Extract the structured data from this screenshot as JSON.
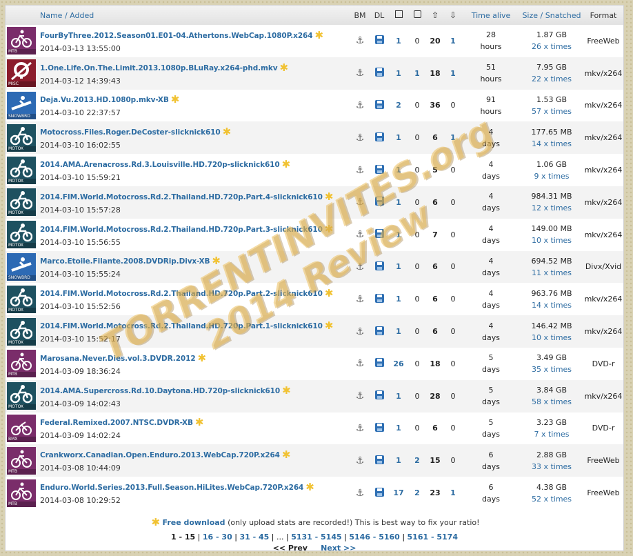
{
  "header": {
    "name": "Name",
    "slash": " / ",
    "added": "Added",
    "bm": "BM",
    "dl": "DL",
    "time_alive": "Time alive",
    "size": "Size",
    "snatched": "Snatched",
    "format": "Format"
  },
  "rows": [
    {
      "cat": "MTB",
      "name": "FourByThree.2012.Season01.E01-04.Athertons.WebCap.1080P.x264",
      "date": "2014-03-13 13:55:00",
      "files": "1",
      "comments": "0",
      "seed": "20",
      "leech": "1",
      "alive_n": "28",
      "alive_u": "hours",
      "size": "1.87 GB",
      "snatched": "26 x times",
      "format": "FreeWeb"
    },
    {
      "cat": "MISC",
      "name": "1.One.Life.On.The.Limit.2013.1080p.BLuRay.x264-phd.mkv",
      "date": "2014-03-12 14:39:43",
      "files": "1",
      "comments": "1",
      "seed": "18",
      "leech": "1",
      "alive_n": "51",
      "alive_u": "hours",
      "size": "7.95 GB",
      "snatched": "22 x times",
      "format": "mkv/x264"
    },
    {
      "cat": "SNOWBRD",
      "name": "Deja.Vu.2013.HD.1080p.mkv-XB",
      "date": "2014-03-10 22:37:57",
      "files": "2",
      "comments": "0",
      "seed": "36",
      "leech": "0",
      "alive_n": "91",
      "alive_u": "hours",
      "size": "1.53 GB",
      "snatched": "57 x times",
      "format": "mkv/x264"
    },
    {
      "cat": "MOTOX",
      "name": "Motocross.Files.Roger.DeCoster-slicknick610",
      "date": "2014-03-10 16:02:55",
      "files": "1",
      "comments": "0",
      "seed": "6",
      "leech": "1",
      "alive_n": "4",
      "alive_u": "days",
      "size": "177.65 MB",
      "snatched": "14 x times",
      "format": "mkv/x264"
    },
    {
      "cat": "MOTOX",
      "name": "2014.AMA.Arenacross.Rd.3.Louisville.HD.720p-slicknick610",
      "date": "2014-03-10 15:59:21",
      "files": "1",
      "comments": "0",
      "seed": "5",
      "leech": "0",
      "alive_n": "4",
      "alive_u": "days",
      "size": "1.06 GB",
      "snatched": "9 x times",
      "format": "mkv/x264"
    },
    {
      "cat": "MOTOX",
      "name": "2014.FIM.World.Motocross.Rd.2.Thailand.HD.720p.Part.4-slicknick610",
      "date": "2014-03-10 15:57:28",
      "files": "1",
      "comments": "0",
      "seed": "6",
      "leech": "0",
      "alive_n": "4",
      "alive_u": "days",
      "size": "984.31 MB",
      "snatched": "12 x times",
      "format": "mkv/x264"
    },
    {
      "cat": "MOTOX",
      "name": "2014.FIM.World.Motocross.Rd.2.Thailand.HD.720p.Part.3-slicknick610",
      "date": "2014-03-10 15:56:55",
      "files": "1",
      "comments": "0",
      "seed": "7",
      "leech": "0",
      "alive_n": "4",
      "alive_u": "days",
      "size": "149.00 MB",
      "snatched": "10 x times",
      "format": "mkv/x264"
    },
    {
      "cat": "SNOWBRD",
      "name": "Marco.Etoile.Filante.2008.DVDRip.Divx-XB",
      "date": "2014-03-10 15:55:24",
      "files": "1",
      "comments": "0",
      "seed": "6",
      "leech": "0",
      "alive_n": "4",
      "alive_u": "days",
      "size": "694.52 MB",
      "snatched": "11 x times",
      "format": "Divx/Xvid"
    },
    {
      "cat": "MOTOX",
      "name": "2014.FIM.World.Motocross.Rd.2.Thailand.HD.720p.Part.2-slicknick610",
      "date": "2014-03-10 15:52:56",
      "files": "1",
      "comments": "0",
      "seed": "6",
      "leech": "0",
      "alive_n": "4",
      "alive_u": "days",
      "size": "963.76 MB",
      "snatched": "14 x times",
      "format": "mkv/x264"
    },
    {
      "cat": "MOTOX",
      "name": "2014.FIM.World.Motocross.Rd.2.Thailand.HD.720p.Part.1-slicknick610",
      "date": "2014-03-10 15:52:17",
      "files": "1",
      "comments": "0",
      "seed": "6",
      "leech": "0",
      "alive_n": "4",
      "alive_u": "days",
      "size": "146.42 MB",
      "snatched": "10 x times",
      "format": "mkv/x264"
    },
    {
      "cat": "MTB",
      "name": "Marosana.Never.Dies.vol.3.DVDR.2012",
      "date": "2014-03-09 18:36:24",
      "files": "26",
      "comments": "0",
      "seed": "18",
      "leech": "0",
      "alive_n": "5",
      "alive_u": "days",
      "size": "3.49 GB",
      "snatched": "35 x times",
      "format": "DVD-r"
    },
    {
      "cat": "MOTOX",
      "name": "2014.AMA.Supercross.Rd.10.Daytona.HD.720p-slicknick610",
      "date": "2014-03-09 14:02:43",
      "files": "1",
      "comments": "0",
      "seed": "28",
      "leech": "0",
      "alive_n": "5",
      "alive_u": "days",
      "size": "3.84 GB",
      "snatched": "58 x times",
      "format": "mkv/x264"
    },
    {
      "cat": "BMX",
      "name": "Federal.Remixed.2007.NTSC.DVDR-XB",
      "date": "2014-03-09 14:02:24",
      "files": "1",
      "comments": "0",
      "seed": "6",
      "leech": "0",
      "alive_n": "5",
      "alive_u": "days",
      "size": "3.23 GB",
      "snatched": "7 x times",
      "format": "DVD-r"
    },
    {
      "cat": "MTB",
      "name": "Crankworx.Canadian.Open.Enduro.2013.WebCap.720P.x264",
      "date": "2014-03-08 10:44:09",
      "files": "1",
      "comments": "2",
      "seed": "15",
      "leech": "0",
      "alive_n": "6",
      "alive_u": "days",
      "size": "2.88 GB",
      "snatched": "33 x times",
      "format": "FreeWeb"
    },
    {
      "cat": "MTB",
      "name": "Enduro.World.Series.2013.Full.Season.HiLites.WebCap.720P.x264",
      "date": "2014-03-08 10:29:52",
      "files": "17",
      "comments": "2",
      "seed": "23",
      "leech": "1",
      "alive_n": "6",
      "alive_u": "days",
      "size": "4.38 GB",
      "snatched": "52 x times",
      "format": "FreeWeb"
    }
  ],
  "footer": {
    "free_label": "Free download",
    "free_note": "(only upload stats are recorded!) This is best way to fix your ratio!",
    "current_page": "1 - 15",
    "pages": [
      "16 - 30",
      "31 - 45",
      "...",
      "5131 - 5145",
      "5146 - 5160",
      "5161 - 5174"
    ],
    "prev": "<< Prev",
    "next": "Next >>"
  },
  "watermark": {
    "line1": "TORRENTINVITES.org",
    "line2": "2014 Review"
  },
  "colors": {
    "MTB": "#7a2d6a",
    "MISC": "#8b1c2c",
    "SNOWBRD": "#2d6ab4",
    "MOTOX": "#1e5160",
    "BMX": "#7a2d6a"
  }
}
